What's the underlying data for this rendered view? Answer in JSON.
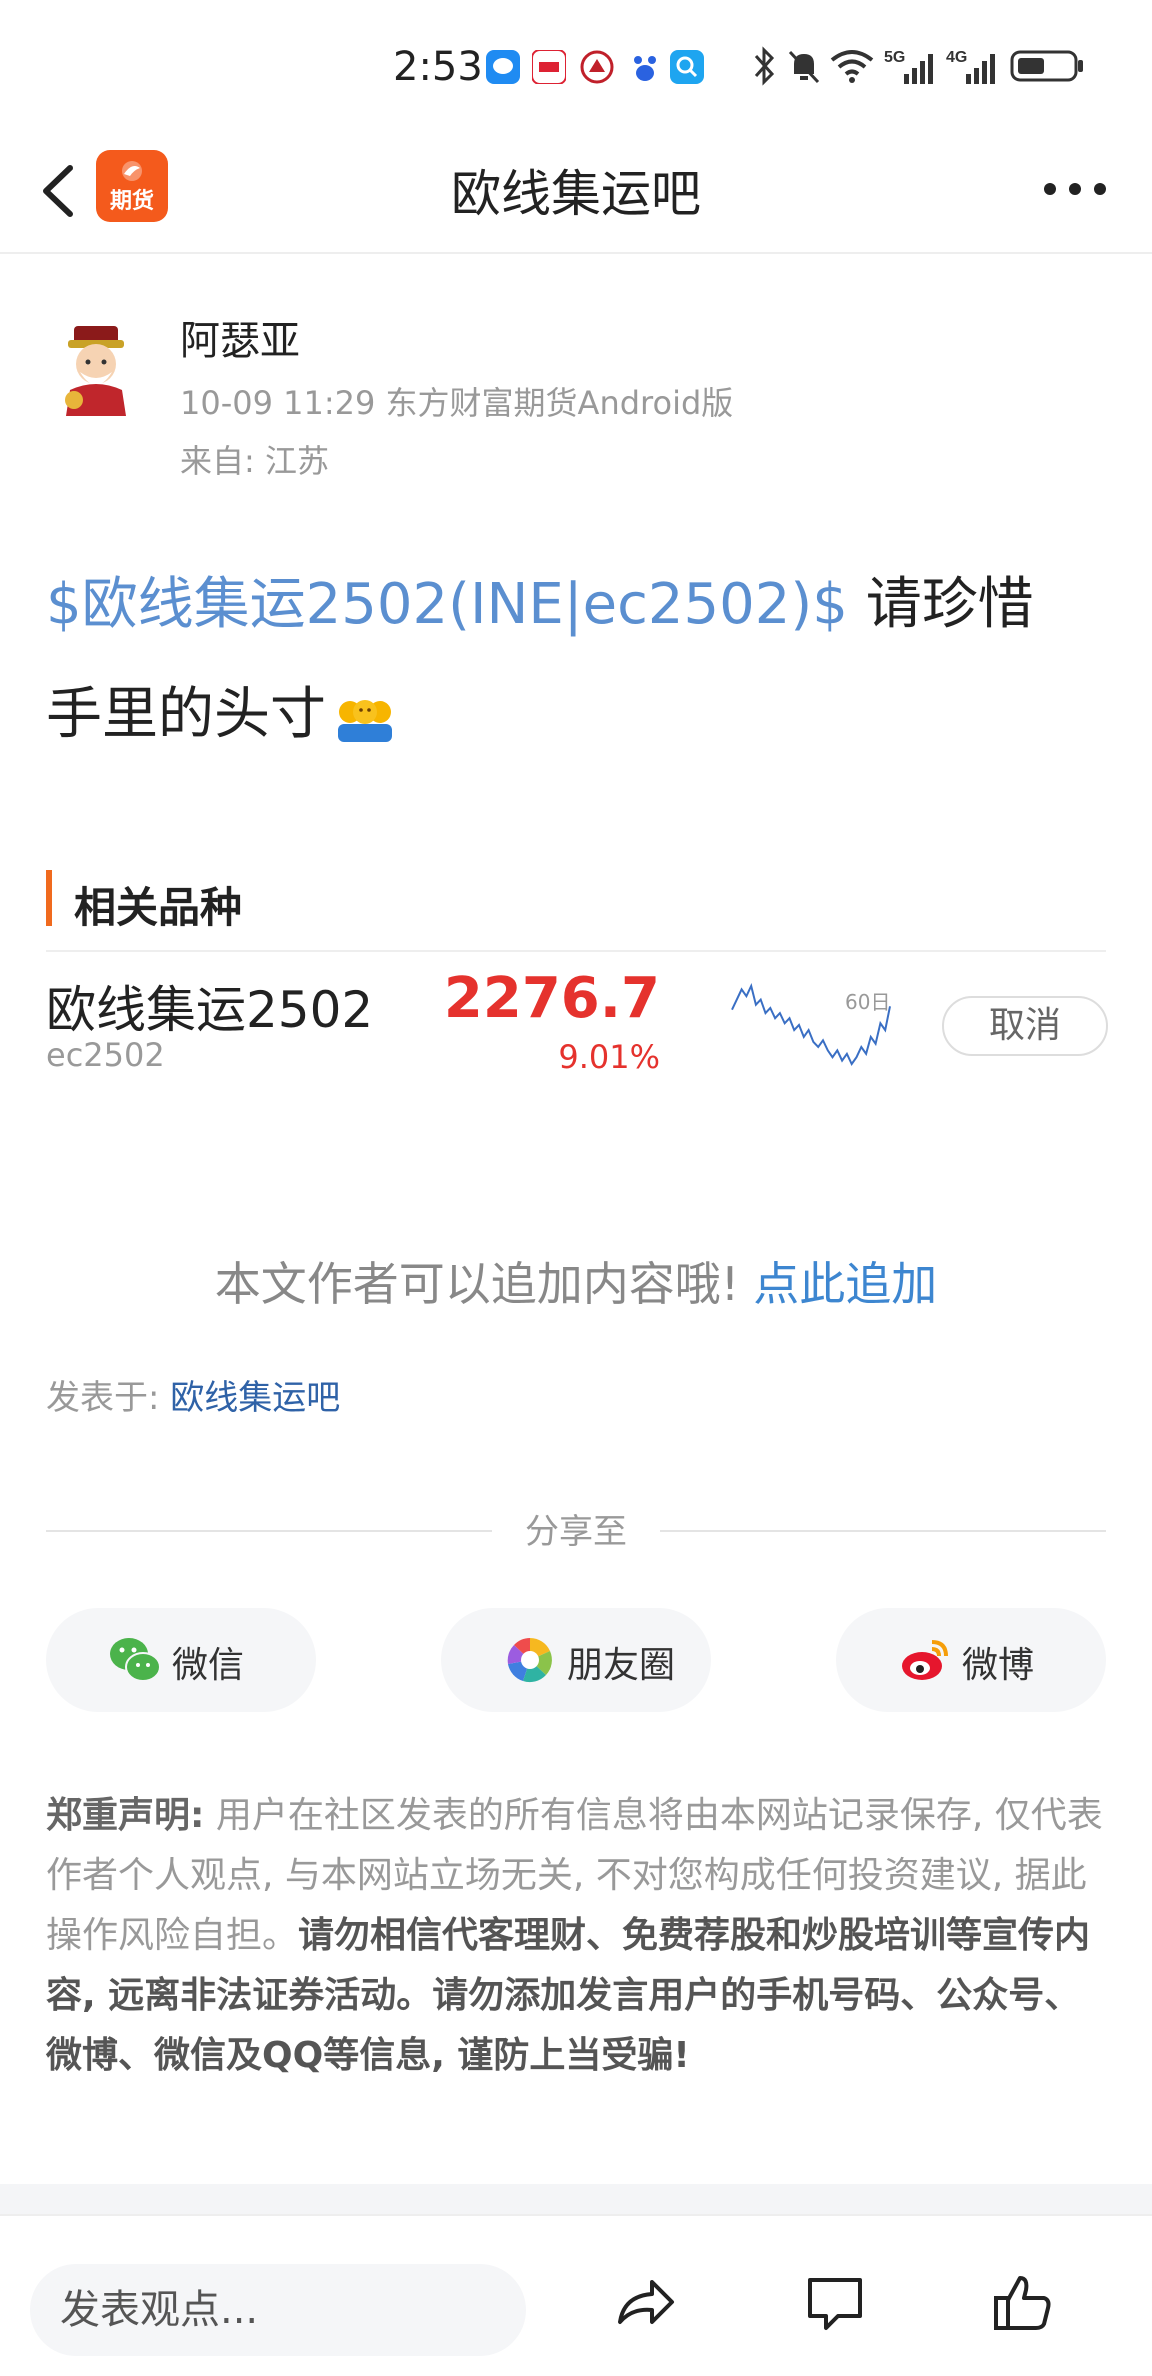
{
  "status_bar": {
    "time": "2:53",
    "notification_icons": [
      "chat-bubble-icon",
      "app-icon",
      "bank-icon",
      "baidu-icon",
      "search-app-icon"
    ],
    "system_icons": [
      "bluetooth-icon",
      "mute-icon",
      "wifi-icon",
      "5g-signal-icon",
      "4g-signal-icon",
      "battery-icon"
    ],
    "signal_5g": "5G",
    "signal_4g": "4G"
  },
  "nav": {
    "title": "欧线集运吧",
    "logo_text": "期货"
  },
  "post": {
    "author": "阿瑟亚",
    "meta": "10-09 11:29 东方财富期货Android版",
    "from": "来自: 江苏",
    "stock_link": "$欧线集运2502(INE|ec2502)$",
    "text_line1": " 请珍惜",
    "text_line2": "手里的头寸"
  },
  "related": {
    "title": "相关品种",
    "name": "欧线集运2502",
    "code": "ec2502",
    "price": "2276.7",
    "change": "9.01%",
    "sparkline_label": "60日",
    "sparkline_values": [
      52,
      58,
      64,
      60,
      66,
      55,
      58,
      50,
      53,
      47,
      50,
      44,
      47,
      40,
      43,
      36,
      40,
      33,
      30,
      34,
      28,
      24,
      28,
      22,
      26,
      20,
      24,
      30,
      26,
      36,
      32,
      44,
      40,
      54
    ],
    "cancel_label": "取消"
  },
  "append": {
    "text": "本文作者可以追加内容哦!",
    "link": "点此追加"
  },
  "posted_in": {
    "label": "发表于: ",
    "bar": "欧线集运吧"
  },
  "share": {
    "label": "分享至",
    "wechat": "微信",
    "moments": "朋友圈",
    "weibo": "微博"
  },
  "disclaimer": {
    "title": "郑重声明:",
    "normal": "用户在社区发表的所有信息将由本网站记录保存, 仅代表作者个人观点, 与本网站立场无关, 不对您构成任何投资建议, 据此操作风险自担。",
    "strong": "请勿相信代客理财、免费荐股和炒股培训等宣传内容, 远离非法证券活动。请勿添加发言用户的手机号码、公众号、微博、微信及QQ等信息, 谨防上当受骗!"
  },
  "bottom_bar": {
    "comment_placeholder": "发表观点..."
  },
  "colors": {
    "accent_orange": "#f06a1e",
    "price_red": "#e5322d",
    "link_blue": "#3d86d0",
    "stock_link_blue": "#5b8fd0"
  }
}
